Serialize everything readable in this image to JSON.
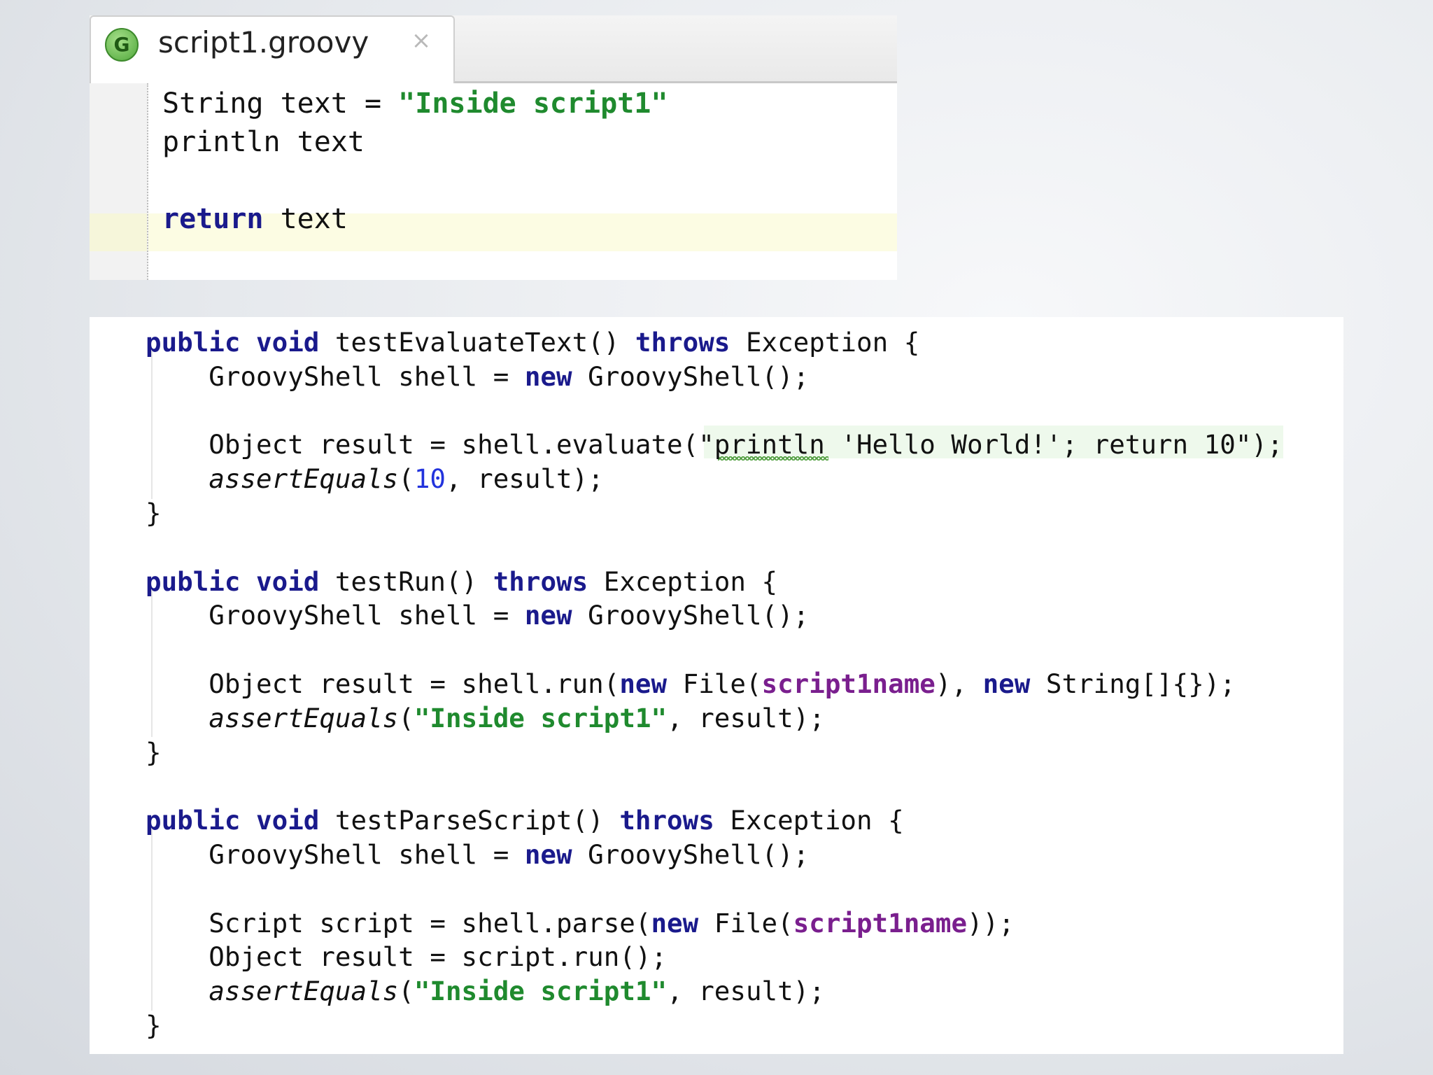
{
  "editor": {
    "tab": {
      "icon_letter": "G",
      "title": "script1.groovy",
      "close_glyph": "×"
    },
    "lines": [
      [
        "String text = ",
        "\"Inside script1\""
      ],
      [
        "println text"
      ],
      [
        ""
      ],
      [
        "return",
        " text"
      ]
    ]
  },
  "code": {
    "m1_sig": [
      "public void",
      " testEvaluateText() ",
      "throws",
      " Exception {"
    ],
    "m1_l1": [
      "    GroovyShell shell = ",
      "new",
      " GroovyShell();"
    ],
    "m1_l2": [
      "    Object result = shell.evaluate(",
      "\"println 'Hello World!'; return 10\"",
      ");"
    ],
    "m1_l3": [
      "    ",
      "assertEquals",
      "(",
      "10",
      ", result);"
    ],
    "m2_sig": [
      "public void",
      " testRun() ",
      "throws",
      " Exception {"
    ],
    "m2_l1": [
      "    GroovyShell shell = ",
      "new",
      " GroovyShell();"
    ],
    "m2_l2": [
      "    Object result = shell.run(",
      "new",
      " File(",
      "script1name",
      "), ",
      "new",
      " String[]{});"
    ],
    "m2_l3": [
      "    ",
      "assertEquals",
      "(",
      "\"Inside script1\"",
      ", result);"
    ],
    "m3_sig": [
      "public void",
      " testParseScript() ",
      "throws",
      " Exception {"
    ],
    "m3_l1": [
      "    GroovyShell shell = ",
      "new",
      " GroovyShell();"
    ],
    "m3_l2": [
      "    Script script = shell.parse(",
      "new",
      " File(",
      "script1name",
      "));"
    ],
    "m3_l3": [
      "    Object result = script.run();"
    ],
    "m3_l4": [
      "    ",
      "assertEquals",
      "(",
      "\"Inside script1\"",
      ", result);"
    ],
    "closing_brace": "}"
  }
}
